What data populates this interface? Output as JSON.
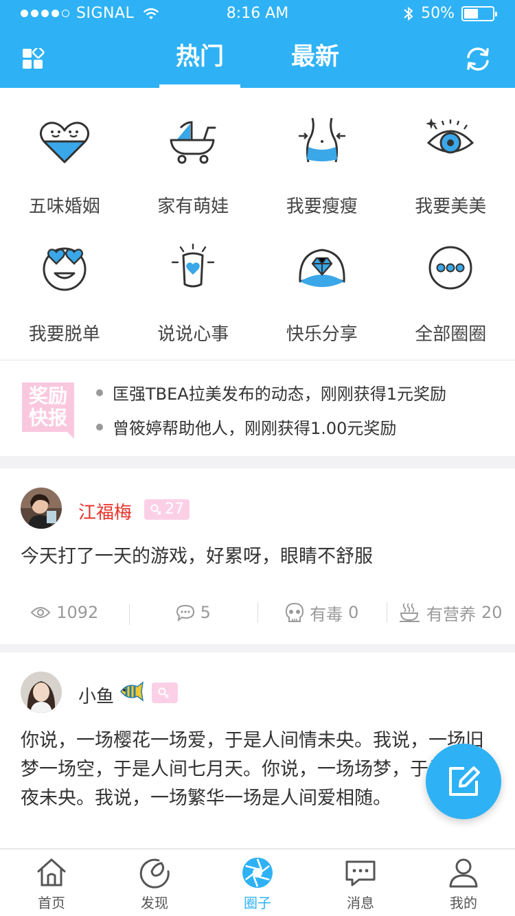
{
  "status_bar": {
    "carrier": "SIGNAL",
    "time": "8:16 AM",
    "battery": "50%",
    "battery_level": 0.5
  },
  "header": {
    "tabs": [
      {
        "label": "热门",
        "active": true
      },
      {
        "label": "最新",
        "active": false
      }
    ],
    "left_icon": "grid-apps-icon",
    "right_icon": "refresh-icon"
  },
  "categories": [
    {
      "label": "五味婚姻",
      "icon": "couple-heart-icon"
    },
    {
      "label": "家有萌娃",
      "icon": "stroller-icon"
    },
    {
      "label": "我要瘦瘦",
      "icon": "waist-icon"
    },
    {
      "label": "我要美美",
      "icon": "eye-icon"
    },
    {
      "label": "我要脱单",
      "icon": "love-eyes-icon"
    },
    {
      "label": "说说心事",
      "icon": "heart-bulb-icon"
    },
    {
      "label": "快乐分享",
      "icon": "diamond-icon"
    },
    {
      "label": "全部圈圈",
      "icon": "more-icon"
    }
  ],
  "reward": {
    "badge_line1": "奖励",
    "badge_line2": "快报",
    "items": [
      "匡强TBEA拉美发布的动态，刚刚获得1元奖励",
      "曾筱婷帮助他人，刚刚获得1.00元奖励"
    ]
  },
  "posts": [
    {
      "username": "江福梅",
      "level": "27",
      "text": "今天打了一天的游戏，好累呀，眼睛不舒服",
      "views": "1092",
      "comments": "5",
      "toxic_label": "有毒",
      "toxic": "0",
      "nutrition_label": "有营养",
      "nutrition": "20"
    },
    {
      "username": "小鱼",
      "level": "",
      "text": "你说，一场樱花一场爱，于是人间情未央。我说，一场旧梦一场空，于是人间七月天。你说，一场场梦，于是人间夜未央。我说，一场繁华一场是人间爱相随。"
    }
  ],
  "bottom_nav": [
    {
      "label": "首页",
      "icon": "home-icon",
      "active": false
    },
    {
      "label": "发现",
      "icon": "discover-icon",
      "active": false
    },
    {
      "label": "圈子",
      "icon": "aperture-icon",
      "active": true
    },
    {
      "label": "消息",
      "icon": "message-icon",
      "active": false
    },
    {
      "label": "我的",
      "icon": "profile-icon",
      "active": false
    }
  ],
  "colors": {
    "brand": "#2eb2f5",
    "badge_pink": "#fbd0e6",
    "username_red": "#e8332a"
  }
}
